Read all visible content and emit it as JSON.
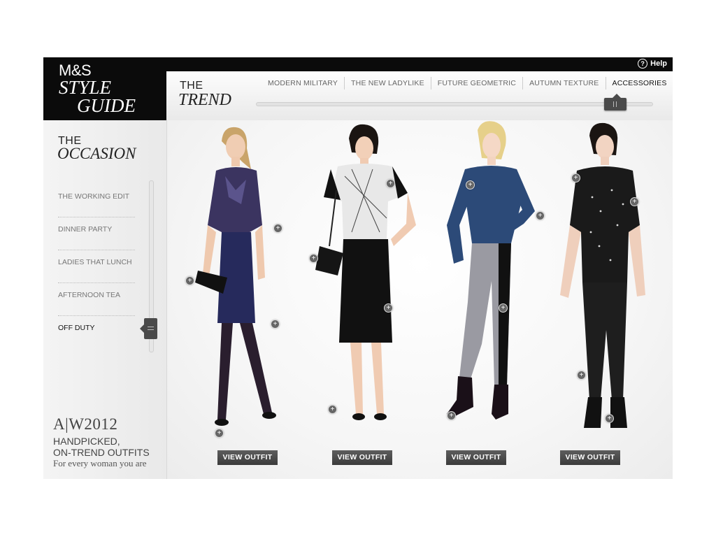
{
  "header": {
    "help_label": "Help",
    "logo": {
      "line1": "M&S",
      "line2": "STYLE",
      "line3": "GUIDE"
    }
  },
  "trend": {
    "the": "THE",
    "title": "TREND",
    "tabs": [
      {
        "label": "MODERN MILITARY"
      },
      {
        "label": "THE NEW LADYLIKE"
      },
      {
        "label": "FUTURE GEOMETRIC"
      },
      {
        "label": "AUTUMN TEXTURE"
      },
      {
        "label": "ACCESSORIES"
      }
    ],
    "active_tab": "ACCESSORIES",
    "slider_position": 0.91
  },
  "occasion": {
    "the": "THE",
    "title": "OCCASION",
    "items": [
      {
        "label": "THE WORKING EDIT"
      },
      {
        "label": "DINNER PARTY"
      },
      {
        "label": "LADIES THAT LUNCH"
      },
      {
        "label": "AFTERNOON TEA"
      },
      {
        "label": "OFF DUTY"
      }
    ],
    "active_item": "OFF DUTY",
    "slider_position": 0.83
  },
  "promo": {
    "year": "A|W2012",
    "line1": "HANDPICKED,",
    "line2": "ON-TREND OUTFITS",
    "line3": "For every woman you are"
  },
  "outfits": [
    {
      "button_label": "VIEW OUTFIT",
      "hotspot_icon": "plus-icon",
      "top_color": "#3b3460",
      "bottom_color": "#262a5c"
    },
    {
      "button_label": "VIEW OUTFIT",
      "hotspot_icon": "plus-icon",
      "top_color": "#e8e8e8",
      "bottom_color": "#111111"
    },
    {
      "button_label": "VIEW OUTFIT",
      "hotspot_icon": "plus-icon",
      "top_color": "#2c4a78",
      "bottom_color": "#9a9aa2"
    },
    {
      "button_label": "VIEW OUTFIT",
      "hotspot_icon": "plus-icon",
      "top_color": "#1a1a1a",
      "bottom_color": "#1e1e1e"
    }
  ],
  "colors": {
    "brand_black": "#0b0b0b",
    "button_grey": "#4a4a4a"
  }
}
